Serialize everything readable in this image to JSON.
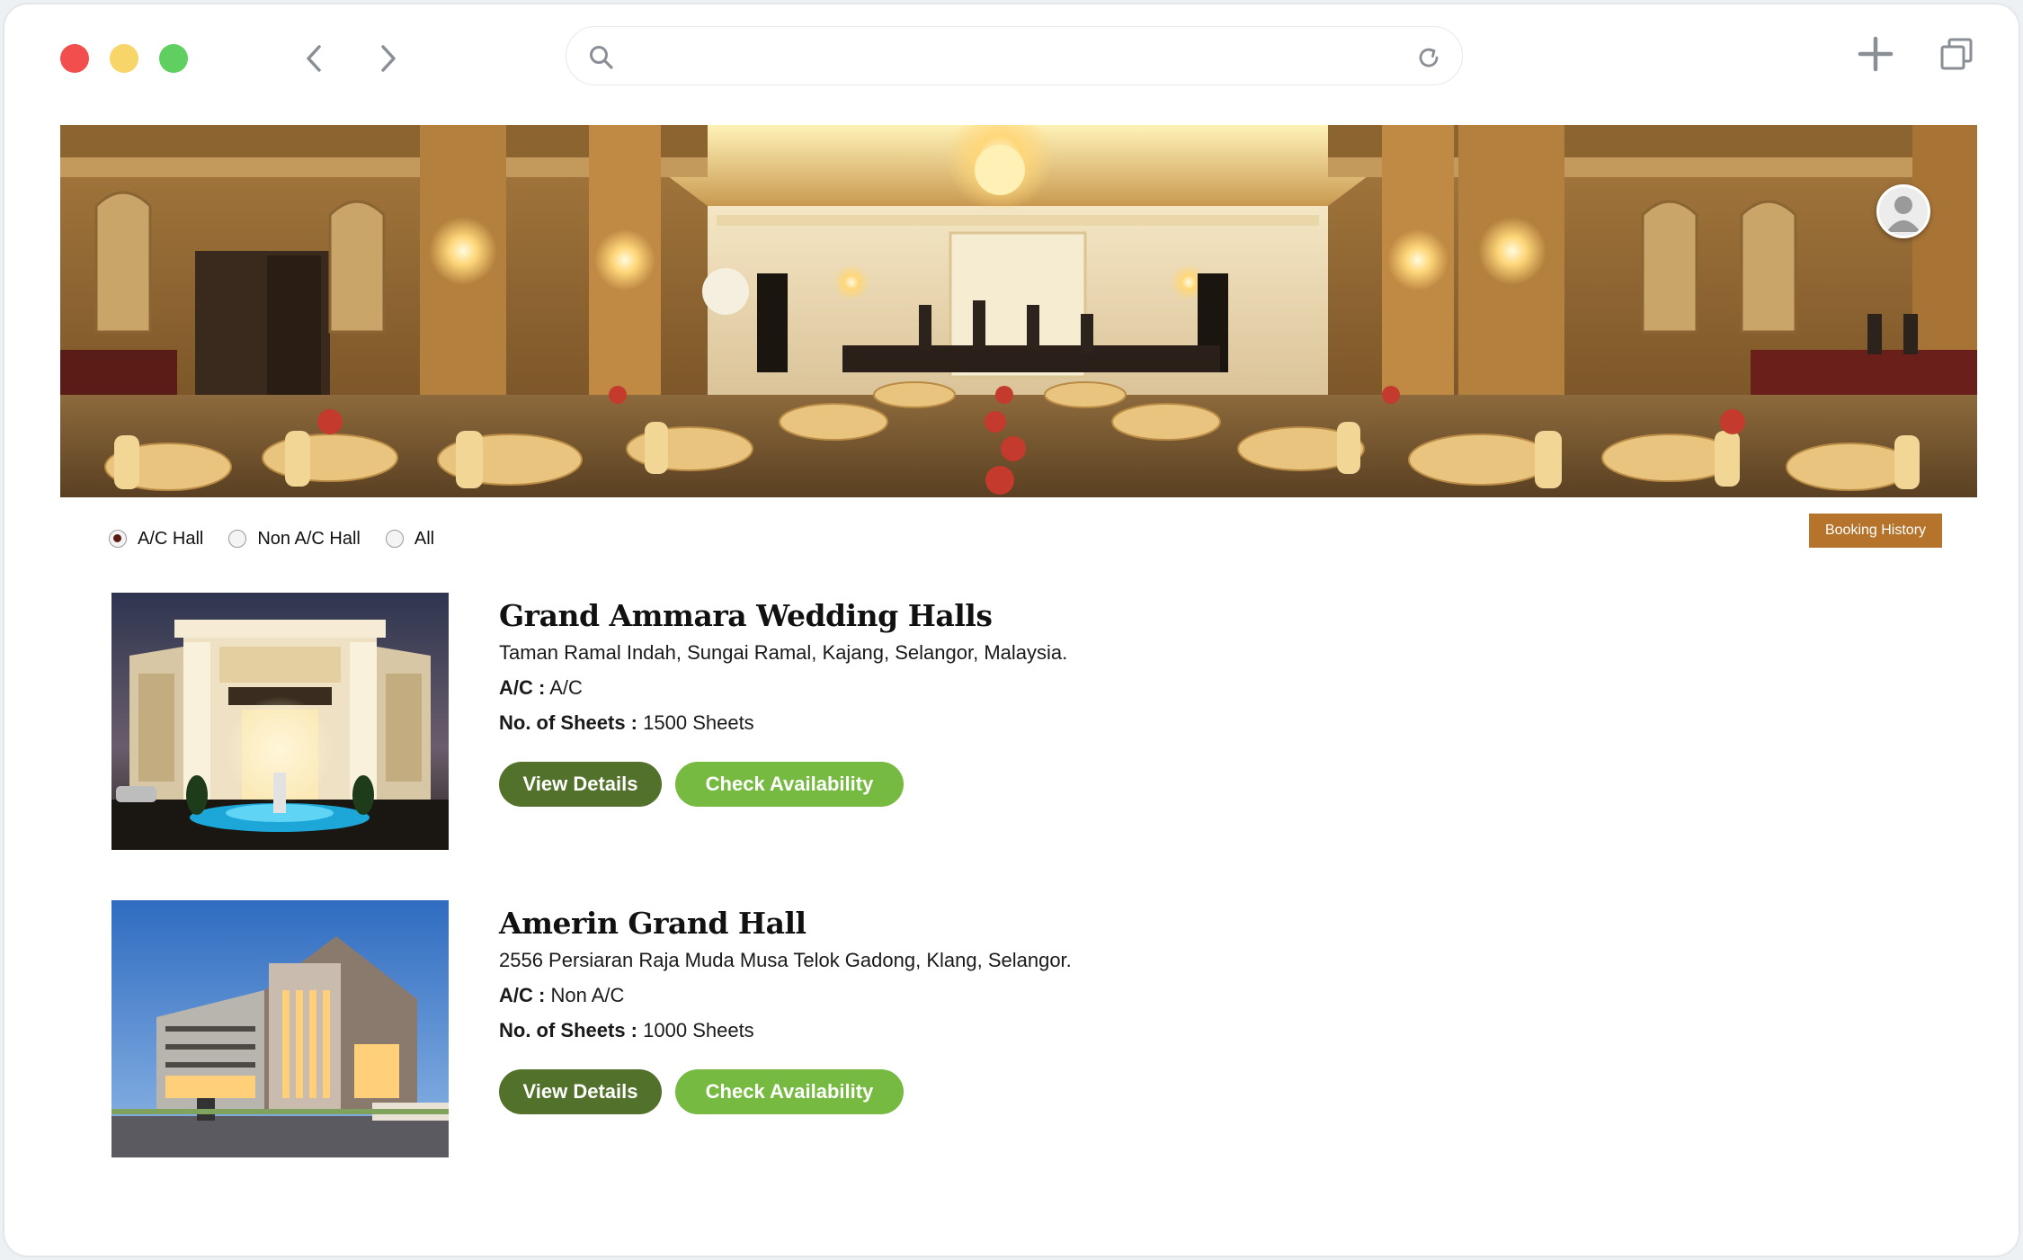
{
  "browser": {
    "url": "",
    "icons": {
      "back": "chevron-left-icon",
      "forward": "chevron-right-icon",
      "search": "search-icon",
      "reload": "reload-icon",
      "new_tab": "plus-icon",
      "tabs": "copy-icon"
    }
  },
  "filters": {
    "options": [
      {
        "label": "A/C Hall",
        "checked": true
      },
      {
        "label": "Non A/C Hall",
        "checked": false
      },
      {
        "label": "All",
        "checked": false
      }
    ]
  },
  "booking_history_label": "Booking History",
  "listings": [
    {
      "name": "Grand Ammara Wedding Halls",
      "address": "Taman Ramal Indah, Sungai Ramal, Kajang, Selangor, Malaysia.",
      "ac_label": "A/C :",
      "ac_value": "A/C",
      "sheets_label": "No. of Sheets :",
      "sheets_value": "1500 Sheets",
      "view_label": "View Details",
      "check_label": "Check Availability"
    },
    {
      "name": "Amerin Grand Hall",
      "address": "2556 Persiaran Raja Muda Musa Telok Gadong, Klang, Selangor.",
      "ac_label": "A/C :",
      "ac_value": "Non A/C",
      "sheets_label": "No. of Sheets :",
      "sheets_value": "1000 Sheets",
      "view_label": "View Details",
      "check_label": "Check Availability"
    }
  ],
  "colors": {
    "booking_button": "#b5732b",
    "view_button": "#52712b",
    "check_button": "#76ba41"
  }
}
